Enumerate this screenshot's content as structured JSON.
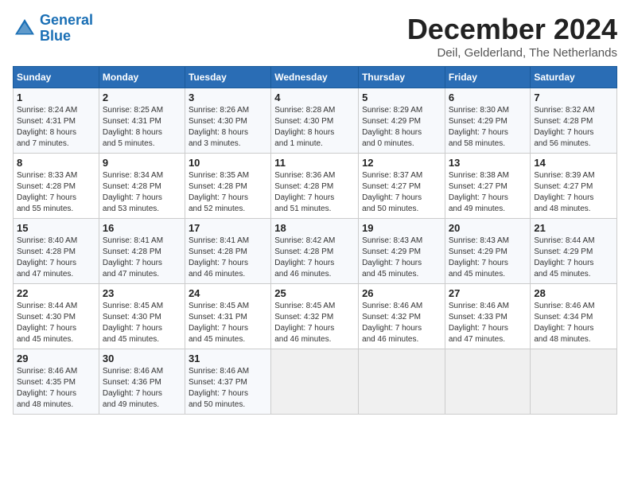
{
  "header": {
    "logo_line1": "General",
    "logo_line2": "Blue",
    "title": "December 2024",
    "subtitle": "Deil, Gelderland, The Netherlands"
  },
  "calendar": {
    "days_of_week": [
      "Sunday",
      "Monday",
      "Tuesday",
      "Wednesday",
      "Thursday",
      "Friday",
      "Saturday"
    ],
    "weeks": [
      [
        {
          "day": "1",
          "detail": "Sunrise: 8:24 AM\nSunset: 4:31 PM\nDaylight: 8 hours\nand 7 minutes."
        },
        {
          "day": "2",
          "detail": "Sunrise: 8:25 AM\nSunset: 4:31 PM\nDaylight: 8 hours\nand 5 minutes."
        },
        {
          "day": "3",
          "detail": "Sunrise: 8:26 AM\nSunset: 4:30 PM\nDaylight: 8 hours\nand 3 minutes."
        },
        {
          "day": "4",
          "detail": "Sunrise: 8:28 AM\nSunset: 4:30 PM\nDaylight: 8 hours\nand 1 minute."
        },
        {
          "day": "5",
          "detail": "Sunrise: 8:29 AM\nSunset: 4:29 PM\nDaylight: 8 hours\nand 0 minutes."
        },
        {
          "day": "6",
          "detail": "Sunrise: 8:30 AM\nSunset: 4:29 PM\nDaylight: 7 hours\nand 58 minutes."
        },
        {
          "day": "7",
          "detail": "Sunrise: 8:32 AM\nSunset: 4:28 PM\nDaylight: 7 hours\nand 56 minutes."
        }
      ],
      [
        {
          "day": "8",
          "detail": "Sunrise: 8:33 AM\nSunset: 4:28 PM\nDaylight: 7 hours\nand 55 minutes."
        },
        {
          "day": "9",
          "detail": "Sunrise: 8:34 AM\nSunset: 4:28 PM\nDaylight: 7 hours\nand 53 minutes."
        },
        {
          "day": "10",
          "detail": "Sunrise: 8:35 AM\nSunset: 4:28 PM\nDaylight: 7 hours\nand 52 minutes."
        },
        {
          "day": "11",
          "detail": "Sunrise: 8:36 AM\nSunset: 4:28 PM\nDaylight: 7 hours\nand 51 minutes."
        },
        {
          "day": "12",
          "detail": "Sunrise: 8:37 AM\nSunset: 4:27 PM\nDaylight: 7 hours\nand 50 minutes."
        },
        {
          "day": "13",
          "detail": "Sunrise: 8:38 AM\nSunset: 4:27 PM\nDaylight: 7 hours\nand 49 minutes."
        },
        {
          "day": "14",
          "detail": "Sunrise: 8:39 AM\nSunset: 4:27 PM\nDaylight: 7 hours\nand 48 minutes."
        }
      ],
      [
        {
          "day": "15",
          "detail": "Sunrise: 8:40 AM\nSunset: 4:28 PM\nDaylight: 7 hours\nand 47 minutes."
        },
        {
          "day": "16",
          "detail": "Sunrise: 8:41 AM\nSunset: 4:28 PM\nDaylight: 7 hours\nand 47 minutes."
        },
        {
          "day": "17",
          "detail": "Sunrise: 8:41 AM\nSunset: 4:28 PM\nDaylight: 7 hours\nand 46 minutes."
        },
        {
          "day": "18",
          "detail": "Sunrise: 8:42 AM\nSunset: 4:28 PM\nDaylight: 7 hours\nand 46 minutes."
        },
        {
          "day": "19",
          "detail": "Sunrise: 8:43 AM\nSunset: 4:29 PM\nDaylight: 7 hours\nand 45 minutes."
        },
        {
          "day": "20",
          "detail": "Sunrise: 8:43 AM\nSunset: 4:29 PM\nDaylight: 7 hours\nand 45 minutes."
        },
        {
          "day": "21",
          "detail": "Sunrise: 8:44 AM\nSunset: 4:29 PM\nDaylight: 7 hours\nand 45 minutes."
        }
      ],
      [
        {
          "day": "22",
          "detail": "Sunrise: 8:44 AM\nSunset: 4:30 PM\nDaylight: 7 hours\nand 45 minutes."
        },
        {
          "day": "23",
          "detail": "Sunrise: 8:45 AM\nSunset: 4:30 PM\nDaylight: 7 hours\nand 45 minutes."
        },
        {
          "day": "24",
          "detail": "Sunrise: 8:45 AM\nSunset: 4:31 PM\nDaylight: 7 hours\nand 45 minutes."
        },
        {
          "day": "25",
          "detail": "Sunrise: 8:45 AM\nSunset: 4:32 PM\nDaylight: 7 hours\nand 46 minutes."
        },
        {
          "day": "26",
          "detail": "Sunrise: 8:46 AM\nSunset: 4:32 PM\nDaylight: 7 hours\nand 46 minutes."
        },
        {
          "day": "27",
          "detail": "Sunrise: 8:46 AM\nSunset: 4:33 PM\nDaylight: 7 hours\nand 47 minutes."
        },
        {
          "day": "28",
          "detail": "Sunrise: 8:46 AM\nSunset: 4:34 PM\nDaylight: 7 hours\nand 48 minutes."
        }
      ],
      [
        {
          "day": "29",
          "detail": "Sunrise: 8:46 AM\nSunset: 4:35 PM\nDaylight: 7 hours\nand 48 minutes."
        },
        {
          "day": "30",
          "detail": "Sunrise: 8:46 AM\nSunset: 4:36 PM\nDaylight: 7 hours\nand 49 minutes."
        },
        {
          "day": "31",
          "detail": "Sunrise: 8:46 AM\nSunset: 4:37 PM\nDaylight: 7 hours\nand 50 minutes."
        },
        {
          "day": "",
          "detail": ""
        },
        {
          "day": "",
          "detail": ""
        },
        {
          "day": "",
          "detail": ""
        },
        {
          "day": "",
          "detail": ""
        }
      ]
    ]
  }
}
